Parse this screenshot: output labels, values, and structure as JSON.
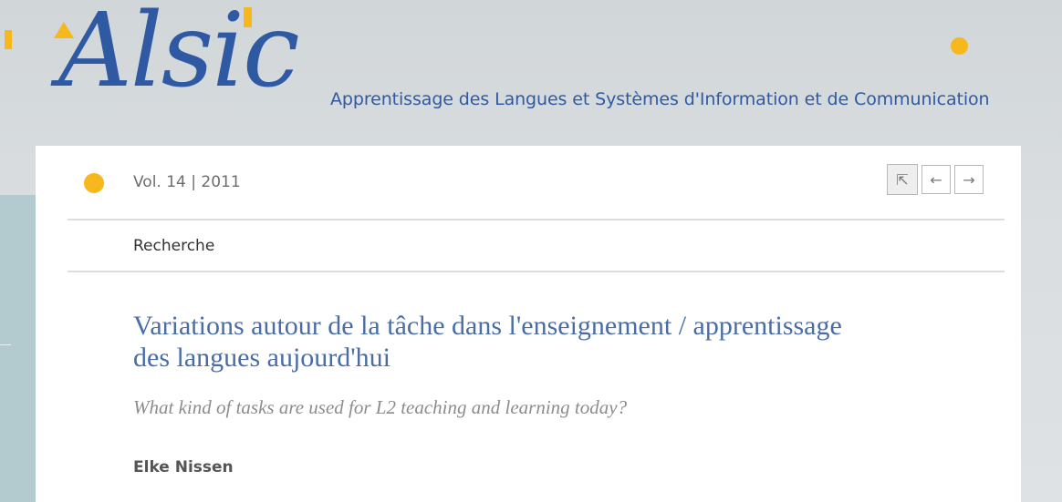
{
  "header": {
    "logo_text": "Alsic",
    "tagline": "Apprentissage des Langues et Systèmes d'Information et de Communication"
  },
  "issue": {
    "volume_label": "Vol. 14 | 2011"
  },
  "nav": {
    "first_icon": "arrow-up-left-icon",
    "prev_icon": "arrow-left-icon",
    "next_icon": "arrow-right-icon",
    "first_glyph": "⇱",
    "prev_glyph": "←",
    "next_glyph": "→"
  },
  "rubric": "Recherche",
  "article": {
    "title": "Variations autour de la tâche dans l'enseignement / apprentissage des langues aujourd'hui",
    "subtitle": "What kind of tasks are used for L2 teaching and learning today?",
    "author": "Elke Nissen"
  },
  "colors": {
    "brand_blue": "#2f5aa3",
    "accent_yellow": "#f6b81c",
    "title_blue": "#4a6da8"
  }
}
